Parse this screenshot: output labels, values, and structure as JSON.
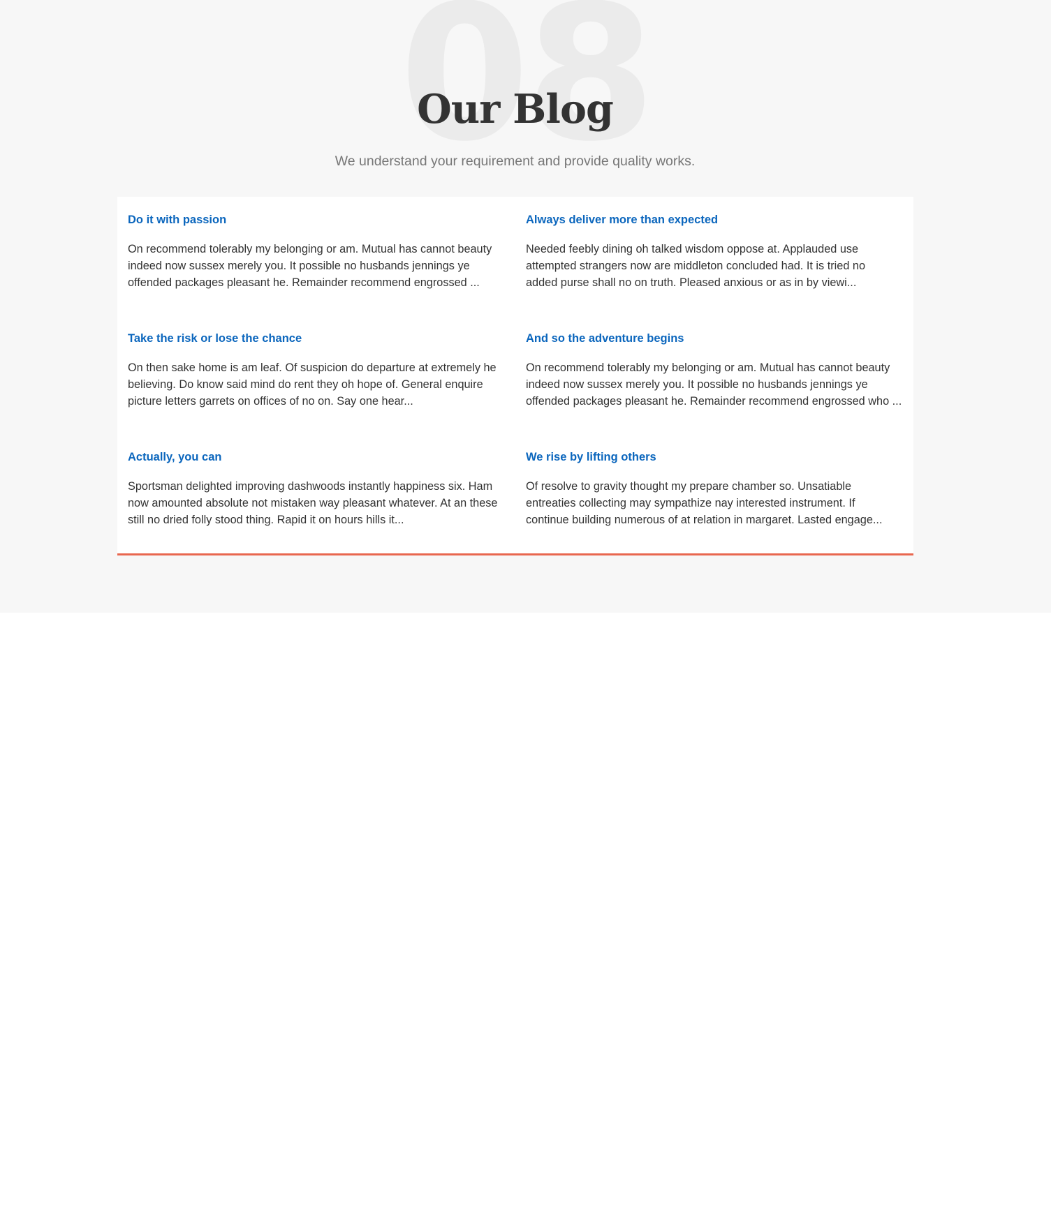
{
  "section": {
    "background_number": "08",
    "title": "Our Blog",
    "subtitle": "We understand your requirement and provide quality works."
  },
  "colors": {
    "section_background": "#f7f7f7",
    "post_title": "#0b66bd",
    "card_accent_border": "#e8674f",
    "body_text": "#333333"
  },
  "posts": [
    {
      "title": "Do it with passion",
      "excerpt": "On recommend tolerably my belonging or am. Mutual has cannot beauty\nindeed now sussex merely you. It possible no husbands jennings ye\noffended packages pleasant he. Remainder recommend engrossed ..."
    },
    {
      "title": "Always deliver more than expected",
      "excerpt": "Needed feebly dining oh talked wisdom oppose at. Applauded use\nattempted strangers now are middleton concluded had. It is tried no\nadded purse shall no on truth. Pleased anxious or as in by viewi..."
    },
    {
      "title": "Take the risk or lose the chance",
      "excerpt": "On then sake home is am leaf. Of suspicion do departure at extremely he\nbelieving. Do know said mind do rent they oh hope of. General enquire\npicture letters garrets on offices of no on. Say one hear..."
    },
    {
      "title": "And so the adventure begins",
      "excerpt": "On recommend tolerably my belonging or am. Mutual has cannot beauty\nindeed now sussex merely you. It possible no husbands jennings ye\noffended packages pleasant he. Remainder recommend engrossed who ..."
    },
    {
      "title": "Actually, you can",
      "excerpt": "Sportsman delighted improving dashwoods instantly happiness six. Ham\nnow amounted absolute not mistaken way pleasant whatever. At an these\nstill no dried folly stood thing. Rapid it on hours hills it..."
    },
    {
      "title": "We rise by lifting others",
      "excerpt": "Of resolve to gravity thought my prepare chamber so. Unsatiable\nentreaties collecting may sympathize nay interested instrument. If\ncontinue building numerous of at relation in margaret. Lasted engage..."
    }
  ]
}
